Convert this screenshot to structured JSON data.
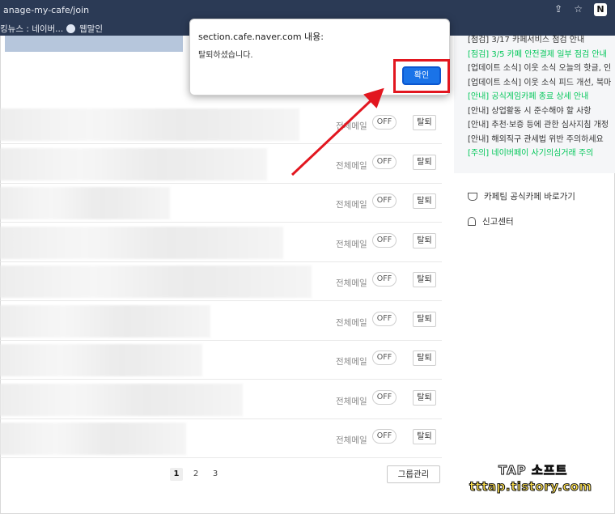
{
  "browser": {
    "url": "anage-my-cafe/join",
    "bookmarks": [
      "킹뉴스 : 네이버...",
      "웹말인"
    ]
  },
  "dialog": {
    "title": "section.cafe.naver.com 내용:",
    "message": "탈퇴하셨습니다.",
    "ok_label": "확인"
  },
  "cafe_rows": [
    {
      "mail": "전체메일",
      "toggle": "OFF",
      "quit": "탈퇴"
    },
    {
      "mail": "전체메일",
      "toggle": "OFF",
      "quit": "탈퇴"
    },
    {
      "mail": "전체메일",
      "toggle": "OFF",
      "quit": "탈퇴"
    },
    {
      "mail": "전체메일",
      "toggle": "OFF",
      "quit": "탈퇴"
    },
    {
      "mail": "전체메일",
      "toggle": "OFF",
      "quit": "탈퇴"
    },
    {
      "mail": "전체메일",
      "toggle": "OFF",
      "quit": "탈퇴"
    },
    {
      "mail": "전체메일",
      "toggle": "OFF",
      "quit": "탈퇴"
    },
    {
      "mail": "전체메일",
      "toggle": "OFF",
      "quit": "탈퇴"
    },
    {
      "mail": "전체메일",
      "toggle": "OFF",
      "quit": "탈퇴"
    }
  ],
  "pagination": {
    "pages": [
      "1",
      "2",
      "3"
    ],
    "current": "1"
  },
  "group_manage_label": "그룹관리",
  "notices": [
    {
      "text": "[점검] 3/17 카페서비스 점검 안내",
      "color": "dark"
    },
    {
      "text": "[점검] 3/5 카페 안전결제 일부 점검 안내",
      "color": "green"
    },
    {
      "text": "[업데이트 소식] 이웃 소식 오늘의 핫글, 인",
      "color": "dark"
    },
    {
      "text": "[업데이트 소식] 이웃 소식 피드 개선, 북마",
      "color": "dark"
    },
    {
      "text": "[안내] 공식게임카페 종료 상세 안내",
      "color": "green"
    },
    {
      "text": "[안내] 상업활동 시 준수해야 할 사항",
      "color": "dark"
    },
    {
      "text": "[안내] 추천·보증 등에 관한 심사지침 개정",
      "color": "dark"
    },
    {
      "text": "[안내] 해외직구 관세법 위반 주의하세요",
      "color": "dark"
    },
    {
      "text": "[주의] 네이버페이 사기의심거래 주의",
      "color": "green"
    }
  ],
  "side_links": {
    "official": "카페팀 공식카페 바로가기",
    "report": "신고센터"
  },
  "watermark": {
    "line1": "TAP 소프트",
    "line2": "tttap.tistory.com"
  },
  "colors": {
    "accent_green": "#03c75a",
    "ok_blue": "#1a73e8",
    "highlight_red": "#e2161f"
  }
}
